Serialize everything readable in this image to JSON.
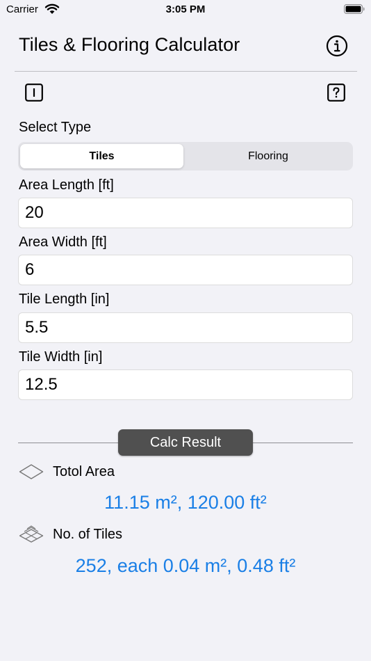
{
  "status_bar": {
    "carrier": "Carrier",
    "time": "3:05 PM"
  },
  "header": {
    "title": "Tiles & Flooring Calculator"
  },
  "select_type": {
    "label": "Select Type",
    "options": [
      "Tiles",
      "Flooring"
    ],
    "selected": "Tiles"
  },
  "inputs": {
    "area_length": {
      "label": "Area Length [ft]",
      "value": "20"
    },
    "area_width": {
      "label": "Area Width [ft]",
      "value": "6"
    },
    "tile_length": {
      "label": "Tile Length [in]",
      "value": "5.5"
    },
    "tile_width": {
      "label": "Tile Width [in]",
      "value": "12.5"
    }
  },
  "calc_button": {
    "label": "Calc Result"
  },
  "results": {
    "total_area": {
      "label": "Totol Area",
      "value": "11.15 m², 120.00 ft²"
    },
    "tiles": {
      "label": "No. of Tiles",
      "value": "252, each 0.04 m², 0.48 ft²"
    }
  },
  "colors": {
    "accent": "#1a7fe6",
    "button_bg": "#505050",
    "background": "#f2f2f7"
  },
  "icons": {
    "info": "info-circle-icon",
    "instructions": "square-i-icon",
    "help": "square-question-icon",
    "area": "diamond-outline-icon",
    "tiles": "stacked-diamonds-icon"
  }
}
